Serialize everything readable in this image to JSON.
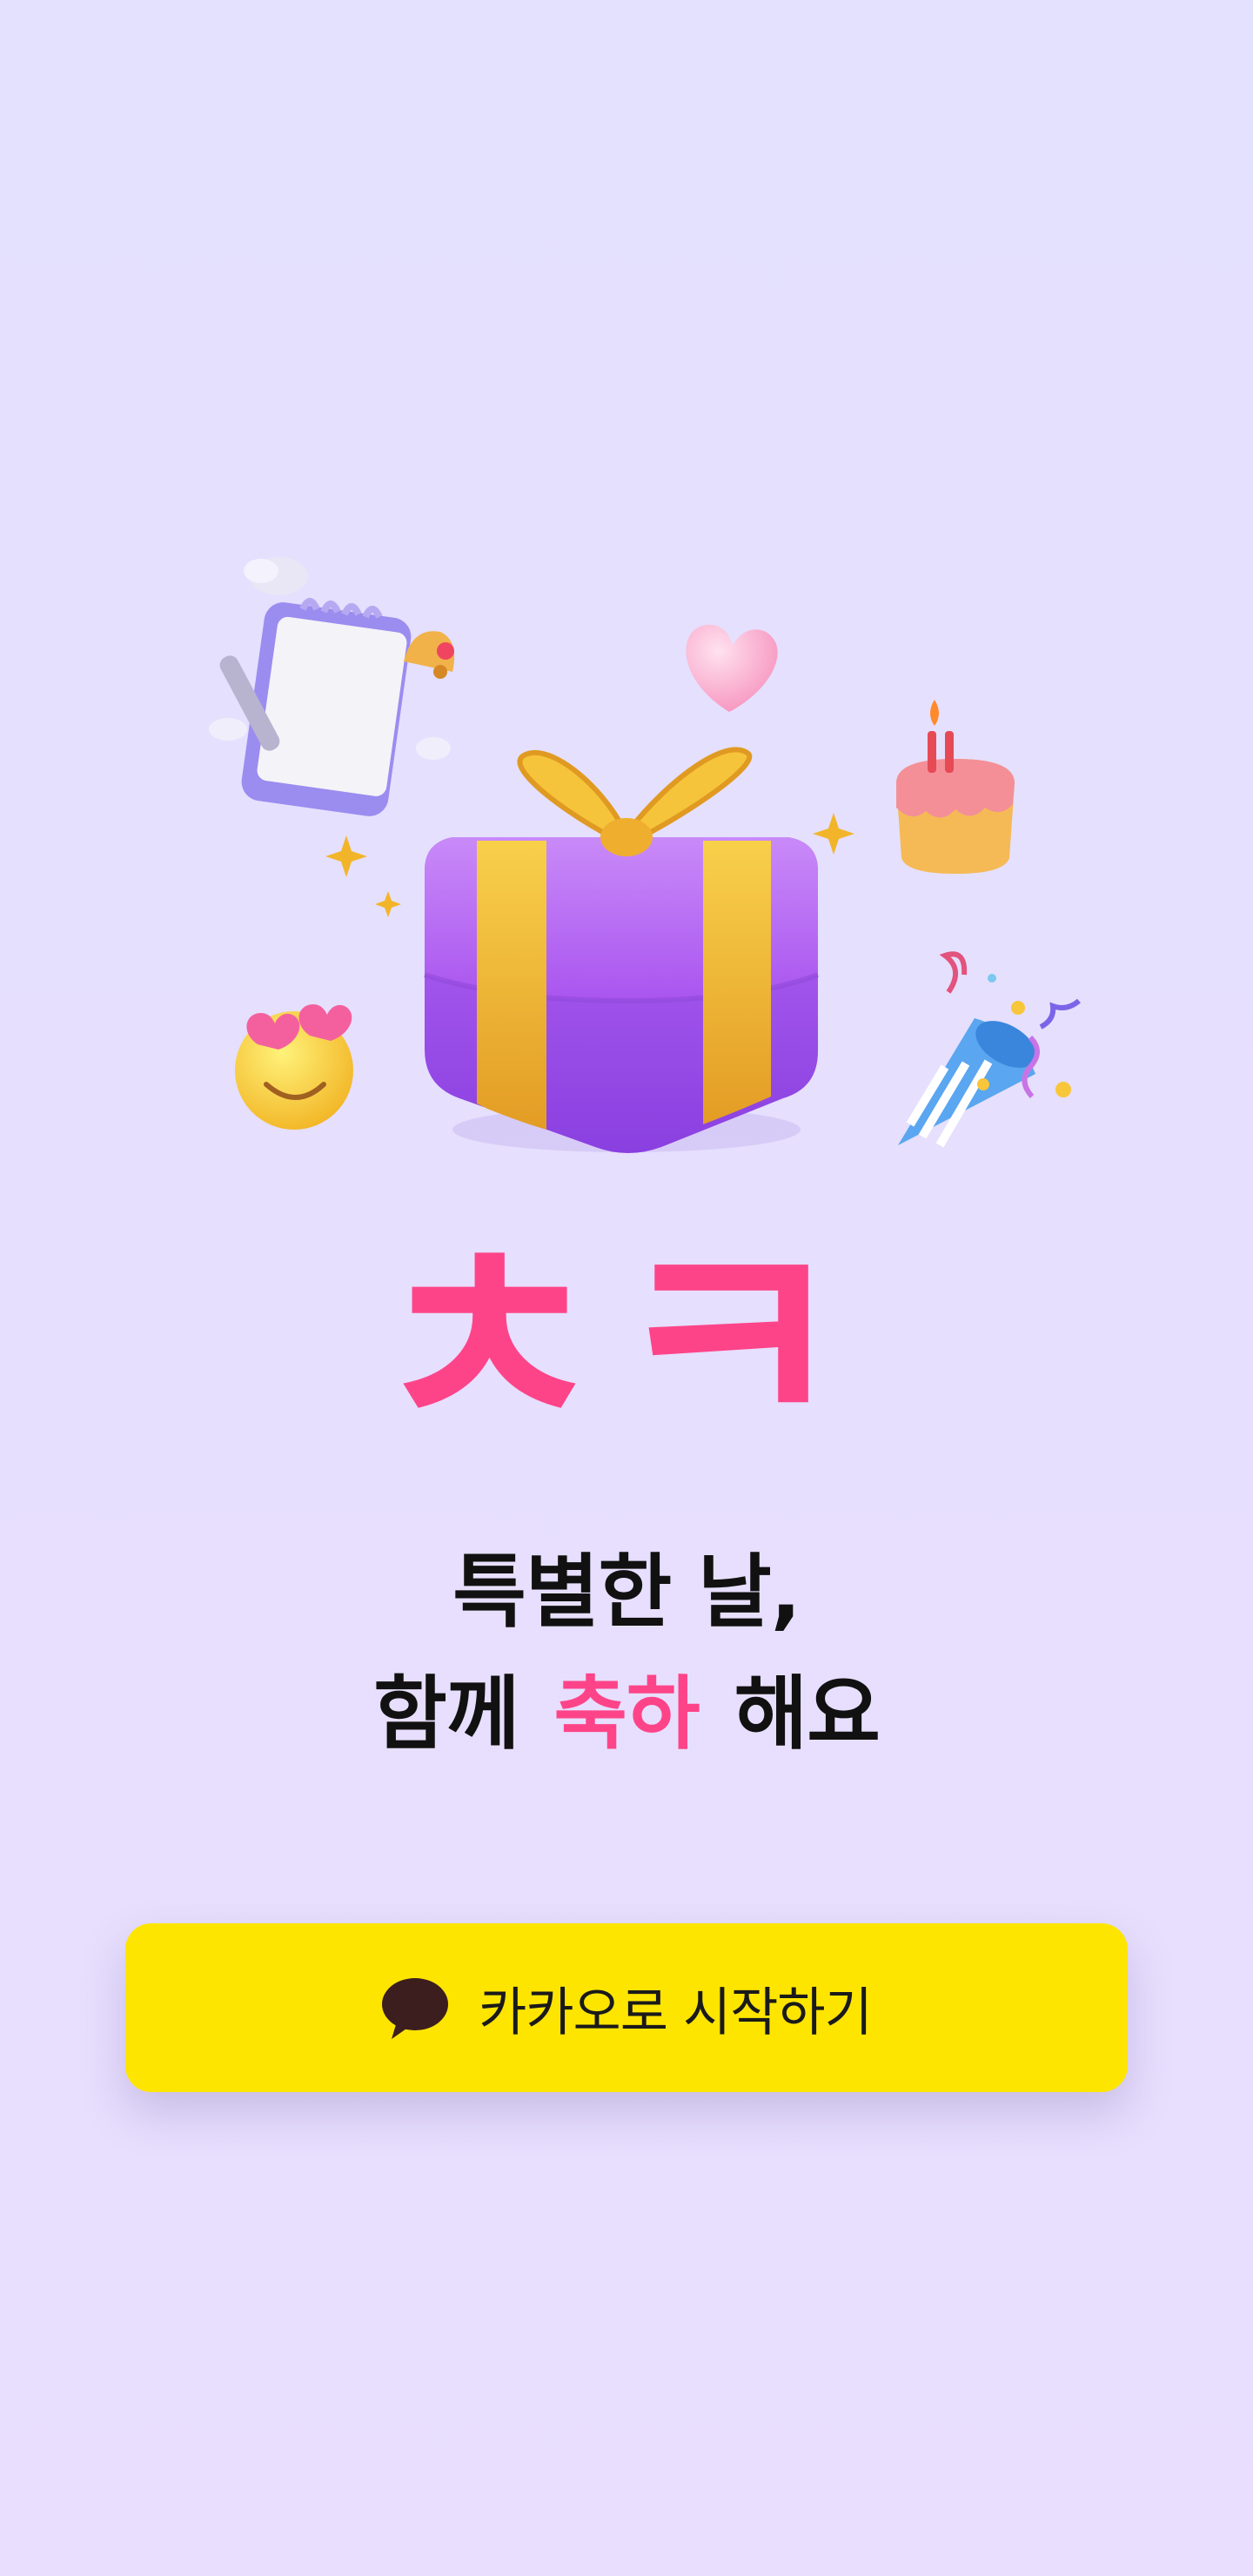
{
  "app": {
    "logo_text": "ㅊㅋ",
    "brand_color": "#fe4489"
  },
  "tagline": {
    "line1": "특별한 날,",
    "line2_before": "함께",
    "line2_highlight": "축하",
    "line2_after": "해요"
  },
  "login": {
    "kakao_label": "카카오로 시작하기",
    "kakao_color": "#fee500",
    "icon": "kakao-talk-bubble-icon"
  },
  "hero_icons": [
    "calendar-icon",
    "alarm-bell-icon",
    "heart-icon",
    "gift-box-icon",
    "birthday-cake-icon",
    "heart-eyes-emoji-icon",
    "party-popper-icon",
    "sparkle-icon"
  ]
}
